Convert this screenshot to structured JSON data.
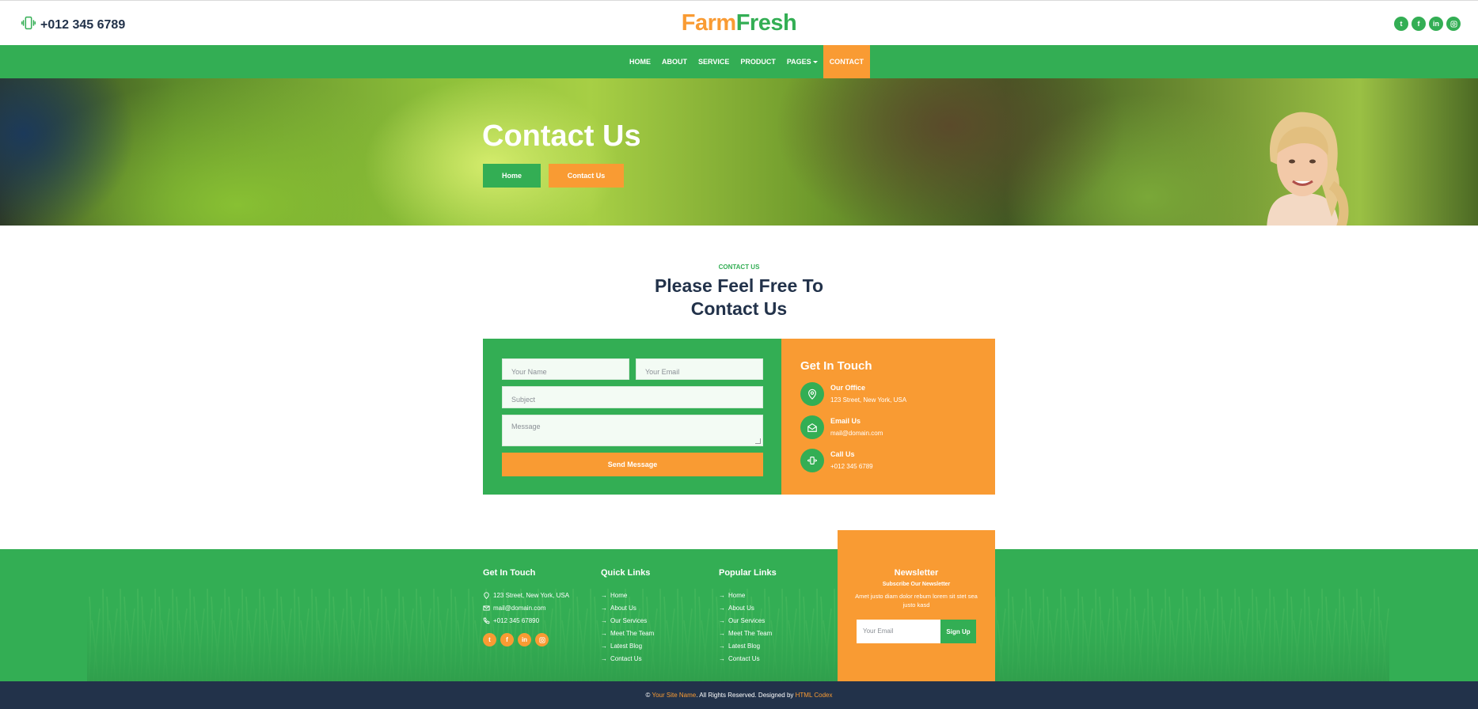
{
  "topbar": {
    "phone": "+012 345 6789",
    "logo_part1": "Farm",
    "logo_part2": "Fresh",
    "socials": [
      "twitter-icon",
      "facebook-icon",
      "linkedin-icon",
      "instagram-icon"
    ]
  },
  "nav": {
    "items": [
      "HOME",
      "ABOUT",
      "SERVICE",
      "PRODUCT",
      "PAGES",
      "CONTACT"
    ],
    "active": "CONTACT"
  },
  "hero": {
    "title": "Contact Us",
    "btn_home": "Home",
    "btn_contact": "Contact Us"
  },
  "section": {
    "eyebrow": "CONTACT US",
    "heading_line1": "Please Feel Free To",
    "heading_line2": "Contact Us"
  },
  "form": {
    "name_placeholder": "Your Name",
    "email_placeholder": "Your Email",
    "subject_placeholder": "Subject",
    "message_placeholder": "Message",
    "send_label": "Send Message"
  },
  "touch": {
    "title": "Get In Touch",
    "office_label": "Our Office",
    "office_value": "123 Street, New York, USA",
    "email_label": "Email Us",
    "email_value": "mail@domain.com",
    "call_label": "Call Us",
    "call_value": "+012 345 6789"
  },
  "footer": {
    "col1": {
      "title": "Get In Touch",
      "address": "123 Street, New York, USA",
      "email": "mail@domain.com",
      "phone": "+012 345 67890"
    },
    "col2": {
      "title": "Quick Links",
      "links": [
        "Home",
        "About Us",
        "Our Services",
        "Meet The Team",
        "Latest Blog",
        "Contact Us"
      ]
    },
    "col3": {
      "title": "Popular Links",
      "links": [
        "Home",
        "About Us",
        "Our Services",
        "Meet The Team",
        "Latest Blog",
        "Contact Us"
      ]
    },
    "newsletter": {
      "title": "Newsletter",
      "subtitle": "Subscribe Our Newsletter",
      "desc": "Amet justo diam dolor rebum lorem sit stet sea justo kasd",
      "placeholder": "Your Email",
      "button": "Sign Up"
    }
  },
  "copyright": {
    "prefix": "© ",
    "site": "Your Site Name",
    "middle": ". All Rights Reserved. Designed by ",
    "designer": "HTML Codex"
  },
  "colors": {
    "green": "#33ae54",
    "orange": "#f99b33",
    "navy": "#22324a"
  }
}
